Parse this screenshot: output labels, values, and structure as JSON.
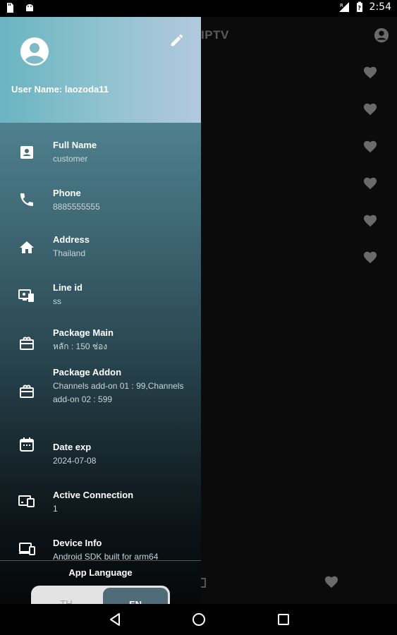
{
  "status_bar": {
    "time": "2:54",
    "left_icons": [
      "sd-card-icon",
      "android-icon"
    ],
    "right_icons": [
      "no-signal-icon",
      "battery-icon"
    ]
  },
  "app": {
    "title": "IPTV",
    "favorite_rows": 7
  },
  "drawer": {
    "header": {
      "username_label": "User Name: laozoda11",
      "edit_icon": "pencil-icon",
      "avatar_icon": "account-circle-icon"
    },
    "items": [
      {
        "label": "Full Name",
        "value": "customer",
        "icon": "contact-card-icon"
      },
      {
        "label": "Phone",
        "value": "8885555555",
        "icon": "phone-icon"
      },
      {
        "label": "Address",
        "value": "Thailand",
        "icon": "home-icon"
      },
      {
        "label": "Line id",
        "value": "ss",
        "icon": "monitor-phone-icon"
      },
      {
        "label": "Package Main",
        "value": "หลัก : 150 ช่อง",
        "icon": "package-icon"
      },
      {
        "label": "Package Addon",
        "value": "Channels add-on 01 : 99,Channels add-on 02 : 599",
        "icon": "package-addon-icon"
      },
      {
        "label": "Date exp",
        "value": "2024-07-08",
        "icon": "calendar-icon"
      },
      {
        "label": "Active Connection",
        "value": "1",
        "icon": "devices-icon"
      },
      {
        "label": "Device Info",
        "value": "Android SDK built for arm64",
        "icon": "device-info-icon"
      }
    ],
    "language": {
      "title": "App Language",
      "options": [
        "TH",
        "EN"
      ],
      "selected": "EN"
    }
  },
  "nav_bar": {
    "buttons": [
      "back-icon",
      "home-circle-icon",
      "recents-icon"
    ]
  },
  "colors": {
    "header_start": "#6ab4c1",
    "header_end": "#b3c8dd",
    "drawer_top": "#5c95a6",
    "drawer_bottom": "#060808",
    "accent_toggle": "#4f6d78"
  }
}
